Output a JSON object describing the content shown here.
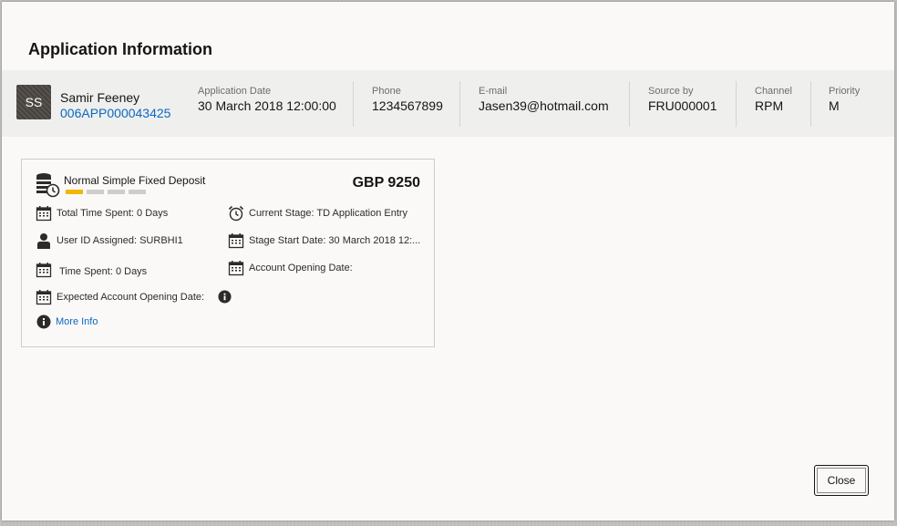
{
  "dialog": {
    "title": "Application Information",
    "close_label": "Close"
  },
  "applicant": {
    "initials": "SS",
    "name": "Samir Feeney",
    "application_id": "006APP000043425"
  },
  "fields": [
    {
      "label": "Application Date",
      "value": "30 March 2018 12:00:00"
    },
    {
      "label": "Phone",
      "value": "1234567899"
    },
    {
      "label": "E-mail",
      "value": "Jasen39@hotmail.com"
    },
    {
      "label": "Source by",
      "value": "FRU000001"
    },
    {
      "label": "Channel",
      "value": "RPM"
    },
    {
      "label": "Priority",
      "value": "M"
    }
  ],
  "card": {
    "product_name": "Normal Simple Fixed Deposit",
    "amount": "GBP 9250",
    "progress": {
      "completed_steps": 1,
      "total_steps": 4
    },
    "total_time_spent": "Total Time Spent: 0 Days",
    "current_stage": "Current Stage: TD Application Entry",
    "user_id_assigned": "User ID Assigned: SURBHI1",
    "stage_start_date": "Stage Start Date: 30 March 2018 12:...",
    "time_spent": "Time Spent: 0 Days",
    "account_opening_date": "Account Opening Date:",
    "expected_account_opening_date": "Expected Account Opening Date:",
    "more_info": "More Info"
  },
  "colors": {
    "accent": "#f0b800",
    "link": "#0a69c2"
  },
  "icons": [
    "deposit-icon",
    "calendar-icon",
    "alarm-clock-icon",
    "user-icon",
    "info-icon"
  ]
}
